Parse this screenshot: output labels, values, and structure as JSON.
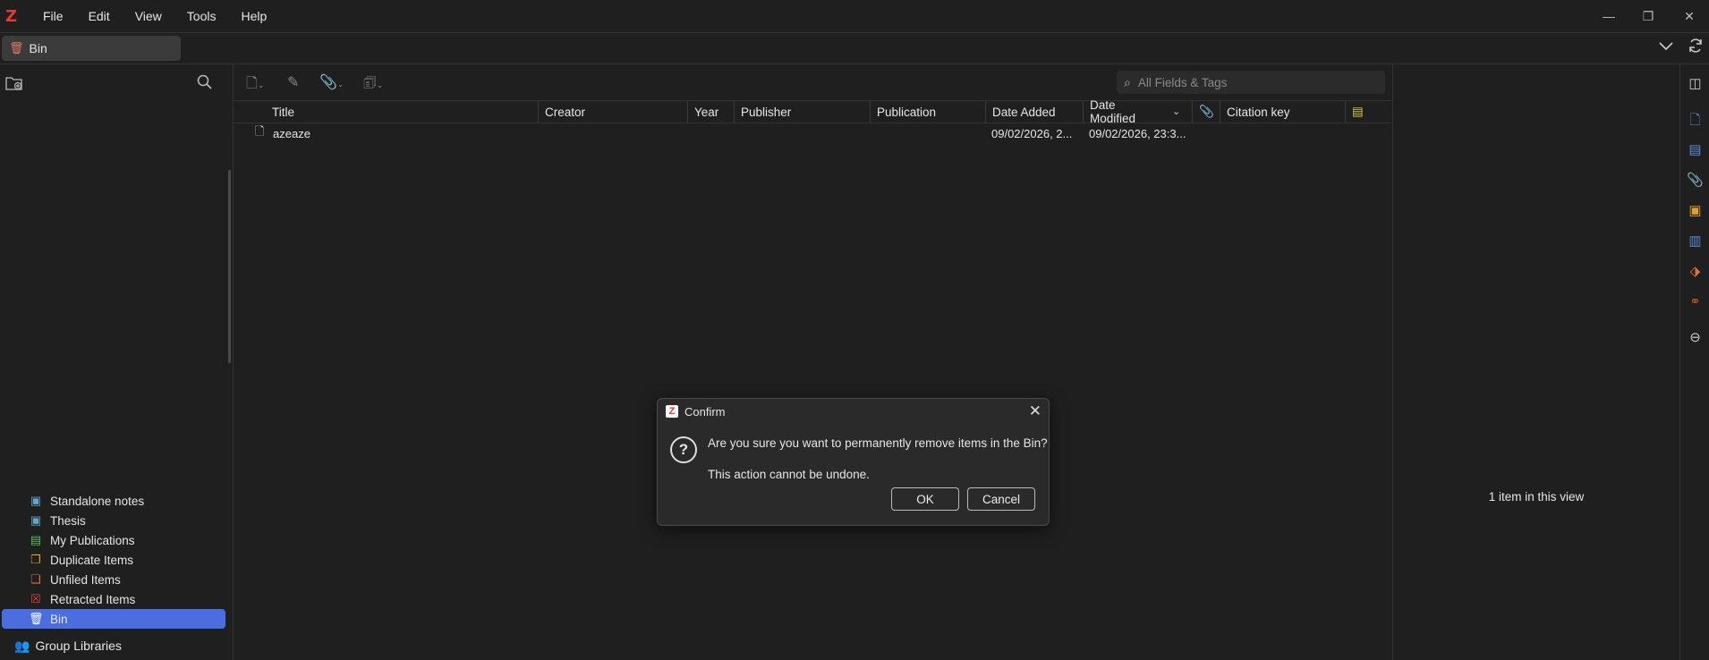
{
  "app": {
    "logo": "Z"
  },
  "menu": [
    "File",
    "Edit",
    "View",
    "Tools",
    "Help"
  ],
  "window_controls": {
    "minimize": "—",
    "restore": "❐",
    "close": "✕"
  },
  "tab": {
    "label": "Bin"
  },
  "left_pane": {
    "collections": [
      {
        "label": "Standalone notes",
        "icon": "folder-saved-search-icon",
        "color": "#5fa8c9"
      },
      {
        "label": "Thesis",
        "icon": "folder-saved-search-icon",
        "color": "#5fa8c9"
      },
      {
        "label": "My Publications",
        "icon": "publications-icon",
        "color": "#5cb85c"
      },
      {
        "label": "Duplicate Items",
        "icon": "duplicate-icon",
        "color": "#e0a030"
      },
      {
        "label": "Unfiled Items",
        "icon": "unfiled-icon",
        "color": "#e0703c"
      },
      {
        "label": "Retracted Items",
        "icon": "retracted-icon",
        "color": "#e04040"
      },
      {
        "label": "Bin",
        "icon": "bin-icon",
        "color": "#ffffff",
        "selected": true
      }
    ],
    "group_libraries": "Group Libraries"
  },
  "search": {
    "placeholder": "All Fields & Tags"
  },
  "columns": {
    "title": "Title",
    "creator": "Creator",
    "year": "Year",
    "publisher": "Publisher",
    "publication": "Publication",
    "date_added": "Date Added",
    "date_modified": "Date Modified",
    "citation_key": "Citation key"
  },
  "items": [
    {
      "title": "azeaze",
      "date_added": "09/02/2026, 2...",
      "date_modified": "09/02/2026, 23:3..."
    }
  ],
  "right_pane": {
    "count": "1 item in this view"
  },
  "dialog": {
    "title": "Confirm",
    "message": "Are you sure you want to permanently remove items in the Bin?",
    "submessage": "This action cannot be undone.",
    "ok": "OK",
    "cancel": "Cancel"
  }
}
